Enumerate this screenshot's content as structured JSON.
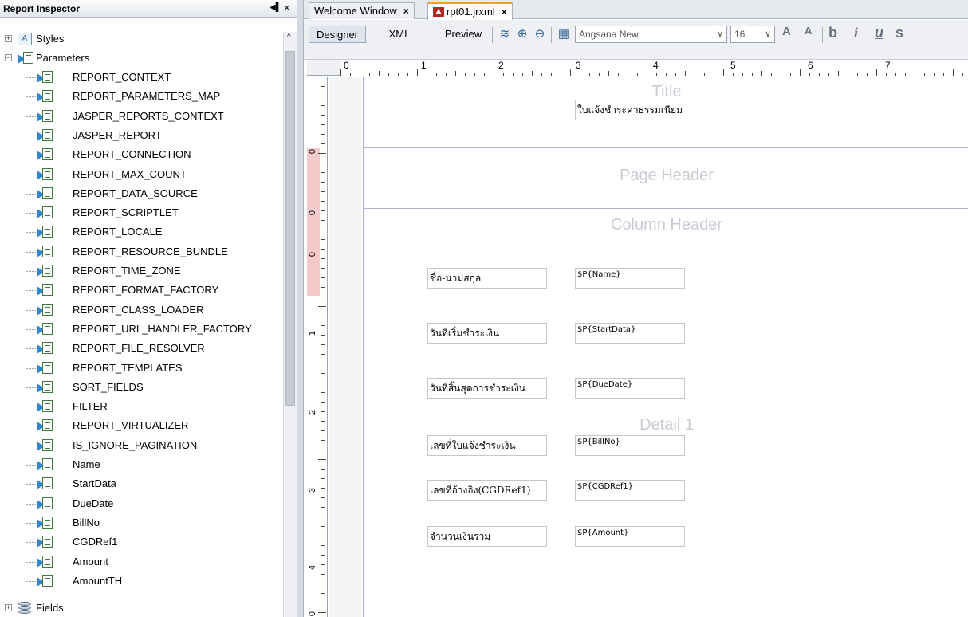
{
  "inspector": {
    "title": "Report Inspector",
    "minimize_glyph": "◀▌",
    "close_glyph": "×",
    "scroll_up_glyph": "^",
    "styles_label": "Styles",
    "styles_icon_text": "A",
    "parameters_label": "Parameters",
    "fields_label": "Fields",
    "parameters": [
      "REPORT_CONTEXT",
      "REPORT_PARAMETERS_MAP",
      "JASPER_REPORTS_CONTEXT",
      "JASPER_REPORT",
      "REPORT_CONNECTION",
      "REPORT_MAX_COUNT",
      "REPORT_DATA_SOURCE",
      "REPORT_SCRIPTLET",
      "REPORT_LOCALE",
      "REPORT_RESOURCE_BUNDLE",
      "REPORT_TIME_ZONE",
      "REPORT_FORMAT_FACTORY",
      "REPORT_CLASS_LOADER",
      "REPORT_URL_HANDLER_FACTORY",
      "REPORT_FILE_RESOLVER",
      "REPORT_TEMPLATES",
      "SORT_FIELDS",
      "FILTER",
      "REPORT_VIRTUALIZER",
      "IS_IGNORE_PAGINATION",
      "Name",
      "StartData",
      "DueDate",
      "BillNo",
      "CGDRef1",
      "Amount",
      "AmountTH"
    ]
  },
  "tabs": [
    {
      "label": "Welcome Window",
      "close": "×"
    },
    {
      "label": "rpt01.jrxml",
      "close": "×"
    }
  ],
  "toolbar": {
    "designer": "Designer",
    "xml": "XML",
    "preview": "Preview",
    "font_name": "Angsana New",
    "font_size": "16",
    "chevron": "∨",
    "bold": "b",
    "italic": "i",
    "underline": "u",
    "increase_font": "A",
    "decrease_font": "A",
    "strike": "s"
  },
  "ruler": {
    "h_numbers": [
      "0",
      "1",
      "2",
      "3",
      "4",
      "5",
      "6",
      "7"
    ],
    "v_numbers": [
      "0",
      "0",
      "0",
      "1",
      "2",
      "3",
      "4",
      "0"
    ]
  },
  "report": {
    "bands": {
      "title": "Title",
      "page_header": "Page Header",
      "column_header": "Column Header",
      "detail": "Detail 1"
    },
    "title_text": "ใบแจ้งชำระค่าธรรมเนียม",
    "labels": [
      "ชื่อ-นามสกุล",
      "วันที่เริ่มชำระเงิน",
      "วันที่สิ้นสุดการชำระเงิน",
      "เลขที่ใบแจ้งชำระเงิน",
      "เลขที่อ้างอิง(CGDRef1)",
      "จำนวนเงินรวม"
    ],
    "fields": [
      "$P{Name}",
      "$P{StartData}",
      "$P{DueDate}",
      "$P{BillNo}",
      "$P{CGDRef1}",
      "$P{Amount}"
    ]
  },
  "colors": {
    "accent_tab": "#f0a030",
    "band_line": "#b8aee0",
    "ruler_pink": "#f3c9c9"
  }
}
